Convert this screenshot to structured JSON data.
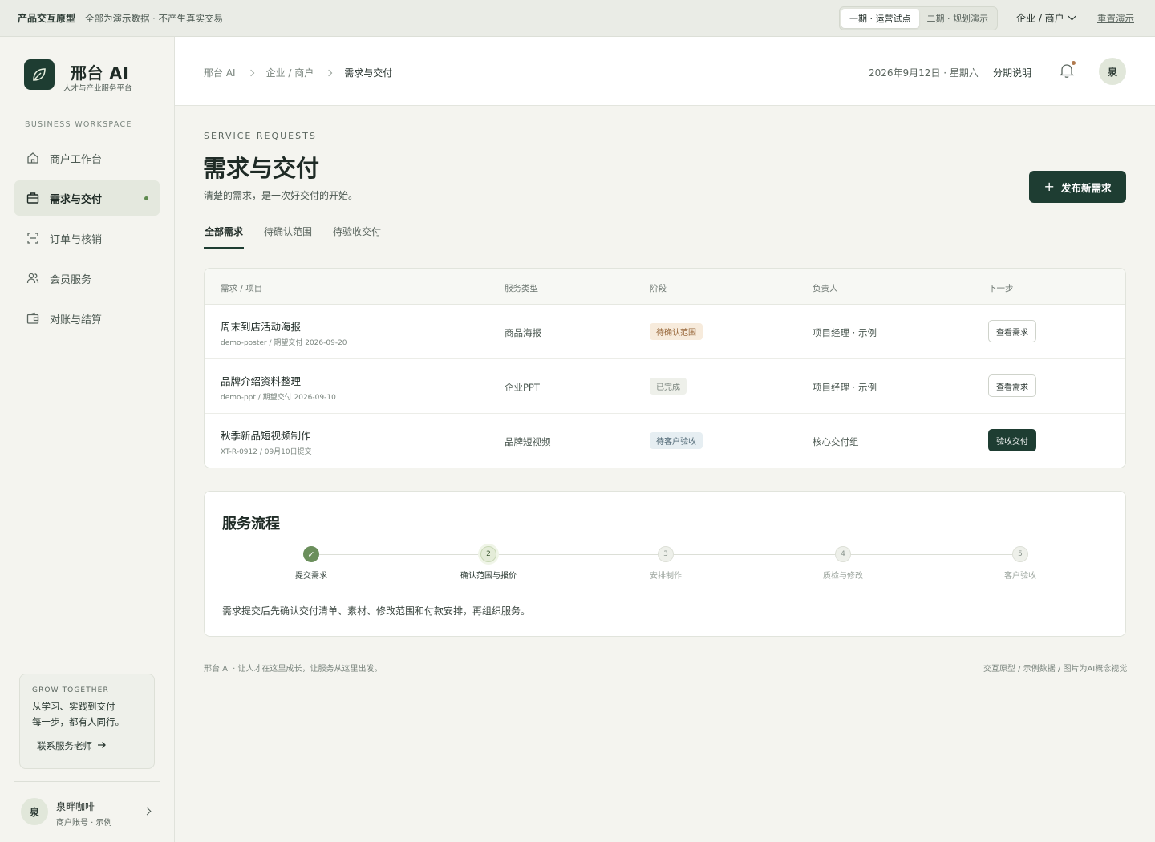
{
  "topbar": {
    "proto_label": "产品交互原型",
    "note": "全部为演示数据 · 不产生真实交易",
    "phases": [
      "一期 · 运营试点",
      "二期 · 规划演示"
    ],
    "role": "企业 / 商户",
    "reset": "重置演示"
  },
  "sidebar": {
    "brand": "邢台 AI",
    "brand_sub": "人才与产业服务平台",
    "workspace_label": "BUSINESS WORKSPACE",
    "items": [
      {
        "label": "商户工作台",
        "icon": "home-icon"
      },
      {
        "label": "需求与交付",
        "icon": "briefcase-icon"
      },
      {
        "label": "订单与核销",
        "icon": "scan-icon"
      },
      {
        "label": "会员服务",
        "icon": "users-icon"
      },
      {
        "label": "对账与结算",
        "icon": "wallet-icon"
      }
    ],
    "grow": {
      "title": "GROW TOGETHER",
      "line1": "从学习、实践到交付",
      "line2": "每一步，都有人同行。",
      "contact": "联系服务老师"
    },
    "user": {
      "avatar": "泉",
      "name": "泉畔咖啡",
      "sub": "商户账号 · 示例"
    }
  },
  "header": {
    "breadcrumb": [
      "邢台 AI",
      "企业 / 商户",
      "需求与交付"
    ],
    "date": "2026年9月12日 · 星期六",
    "link": "分期说明",
    "avatar": "泉"
  },
  "main": {
    "eyebrow": "SERVICE REQUESTS",
    "title": "需求与交付",
    "subtitle": "清楚的需求，是一次好交付的开始。",
    "new_button": "发布新需求",
    "tabs": [
      "全部需求",
      "待确认范围",
      "待验收交付"
    ],
    "table": {
      "headers": [
        "需求 / 项目",
        "服务类型",
        "阶段",
        "负责人",
        "下一步"
      ],
      "rows": [
        {
          "title": "周末到店活动海报",
          "meta": "demo-poster / 期望交付 2026-09-20",
          "type": "商品海报",
          "stage": "待确认范围",
          "owner": "项目经理 · 示例",
          "action": "查看需求"
        },
        {
          "title": "品牌介绍资料整理",
          "meta": "demo-ppt / 期望交付 2026-09-10",
          "type": "企业PPT",
          "stage": "已完成",
          "owner": "项目经理 · 示例",
          "action": "查看需求"
        },
        {
          "title": "秋季新品短视频制作",
          "meta": "XT-R-0912 / 09月10日提交",
          "type": "品牌短视频",
          "stage": "待客户验收",
          "owner": "核心交付组",
          "action": "验收交付"
        }
      ]
    },
    "flow": {
      "title": "服务流程",
      "steps": [
        {
          "num": "✓",
          "label": "提交需求"
        },
        {
          "num": "2",
          "label": "确认范围与报价"
        },
        {
          "num": "3",
          "label": "安排制作"
        },
        {
          "num": "4",
          "label": "质检与修改"
        },
        {
          "num": "5",
          "label": "客户验收"
        }
      ],
      "description": "需求提交后先确认交付清单、素材、修改范围和付款安排，再组织服务。"
    }
  },
  "footer": {
    "left": "邢台 AI · 让人才在这里成长，让服务从这里出发。",
    "right": "交互原型 / 示例数据 / 图片为AI概念视觉"
  },
  "colors": {
    "brand": "#1e3d32",
    "accent_dot": "#5e8a4f",
    "stage_pending": "#f7ebdc",
    "stage_done": "#eef0ea",
    "stage_review": "#e6eef2"
  }
}
